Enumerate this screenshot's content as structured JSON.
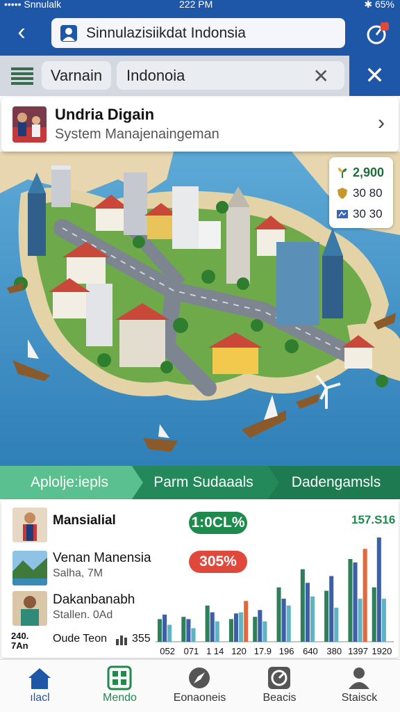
{
  "status_bar": {
    "carrier": "••••• Snnulalk",
    "time": "222 PM",
    "battery": "65%"
  },
  "header": {
    "search_text": "Sinnulazisiikdat Indonsia"
  },
  "filter": {
    "variant_label": "Varnain",
    "query": "Indonoia"
  },
  "info_card": {
    "title": "Undria Digain",
    "subtitle": "System Manajenaingeman"
  },
  "map_stats": [
    {
      "icon": "sprout-icon",
      "value": "2,900"
    },
    {
      "icon": "shield-icon",
      "value": "30 80"
    },
    {
      "icon": "flag-icon",
      "value": "30 30"
    }
  ],
  "tabs": [
    {
      "label": "Aplolje:iepls",
      "active": true
    },
    {
      "label": "Parm Sudaaals",
      "active": false
    },
    {
      "label": "Dadengamsls",
      "active": false
    }
  ],
  "list": [
    {
      "title": "Mansialial",
      "subtitle": ""
    },
    {
      "title": "Venan Manensia",
      "subtitle": "Salha, 7M"
    },
    {
      "title": "Dakanbanabh",
      "subtitle": "Stallen. 0Ad"
    }
  ],
  "footer_row": {
    "left_value": "240. 7An",
    "label": "Oude Teon",
    "count": "355"
  },
  "badges": [
    {
      "text": "1:0CL%",
      "color": "#1e8a4c"
    },
    {
      "text": "305%",
      "color": "#e0483c"
    }
  ],
  "chart_data": {
    "type": "bar",
    "corner_value": "157.S16",
    "categories": [
      "052",
      "071",
      "1 14",
      "120",
      "17.9",
      "196",
      "640",
      "380",
      "1397",
      "1920"
    ],
    "series": [
      {
        "color": "#2f7f5a",
        "values": [
          20,
          22,
          32,
          20,
          22,
          48,
          64,
          45,
          73,
          48
        ]
      },
      {
        "color": "#3c5fa8",
        "values": [
          24,
          20,
          26,
          25,
          28,
          38,
          52,
          58,
          70,
          92
        ]
      },
      {
        "color": "#5fb3c2",
        "values": [
          15,
          12,
          18,
          26,
          18,
          32,
          40,
          30,
          38,
          38
        ]
      },
      {
        "color": "#e06a3c",
        "values": [
          0,
          0,
          0,
          36,
          0,
          0,
          0,
          0,
          82,
          0
        ]
      }
    ],
    "ylim": [
      0,
      100
    ]
  },
  "bottom_nav": [
    {
      "icon": "home-icon",
      "label": "ılacl",
      "color": "#1f57a8"
    },
    {
      "icon": "grid-icon",
      "label": "Mendo",
      "color": "#1e8a4c"
    },
    {
      "icon": "compass-icon",
      "label": "Eonaoneis",
      "color": "#555555"
    },
    {
      "icon": "clock-icon",
      "label": "Beacis",
      "color": "#555555"
    },
    {
      "icon": "user-icon",
      "label": "Staisck",
      "color": "#555555"
    }
  ]
}
